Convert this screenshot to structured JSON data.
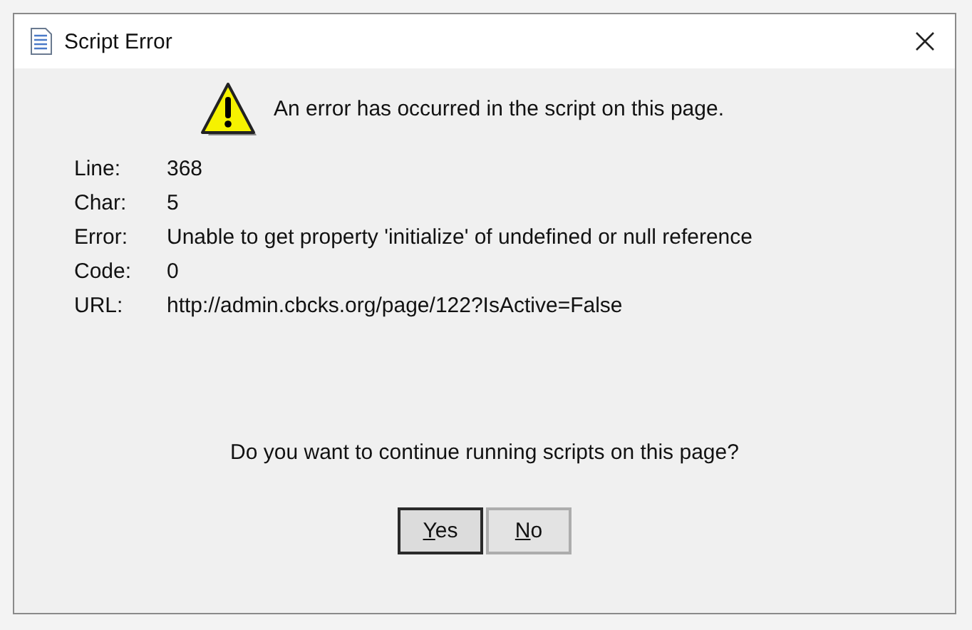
{
  "window": {
    "title": "Script Error"
  },
  "message": "An error has occurred in the script on this page.",
  "details": [
    {
      "label": "Line:",
      "value": "368"
    },
    {
      "label": "Char:",
      "value": "5"
    },
    {
      "label": "Error:",
      "value": "Unable to get property 'initialize' of undefined or null reference"
    },
    {
      "label": "Code:",
      "value": "0"
    },
    {
      "label": "URL:",
      "value": "http://admin.cbcks.org/page/122?IsActive=False"
    }
  ],
  "question": "Do you want to continue running scripts on this page?",
  "buttons": [
    {
      "label": "Yes",
      "default": true
    },
    {
      "label": "No",
      "default": false
    }
  ]
}
